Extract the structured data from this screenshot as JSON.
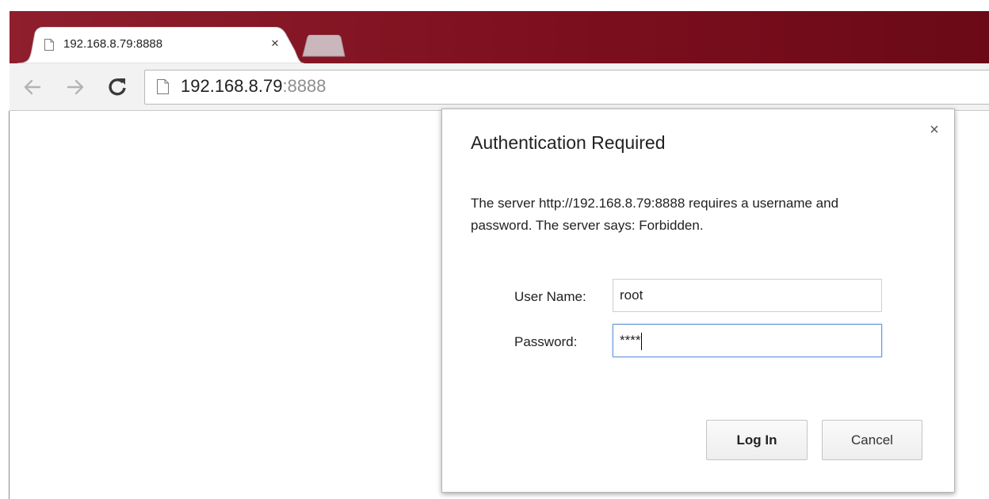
{
  "browser": {
    "tab": {
      "title": "192.168.8.79:8888",
      "close_symbol": "×"
    },
    "omnibox": {
      "host": "192.168.8.79",
      "port": ":8888"
    },
    "colors": {
      "frame": "#7d0f1e"
    }
  },
  "dialog": {
    "title": "Authentication Required",
    "close_symbol": "×",
    "message_line1": "The server http://192.168.8.79:8888 requires a username and",
    "message_line2": "password. The server says: Forbidden.",
    "username_label": "User Name:",
    "username_value": "root",
    "password_label": "Password:",
    "password_value": "****",
    "login_label": "Log In",
    "cancel_label": "Cancel"
  }
}
